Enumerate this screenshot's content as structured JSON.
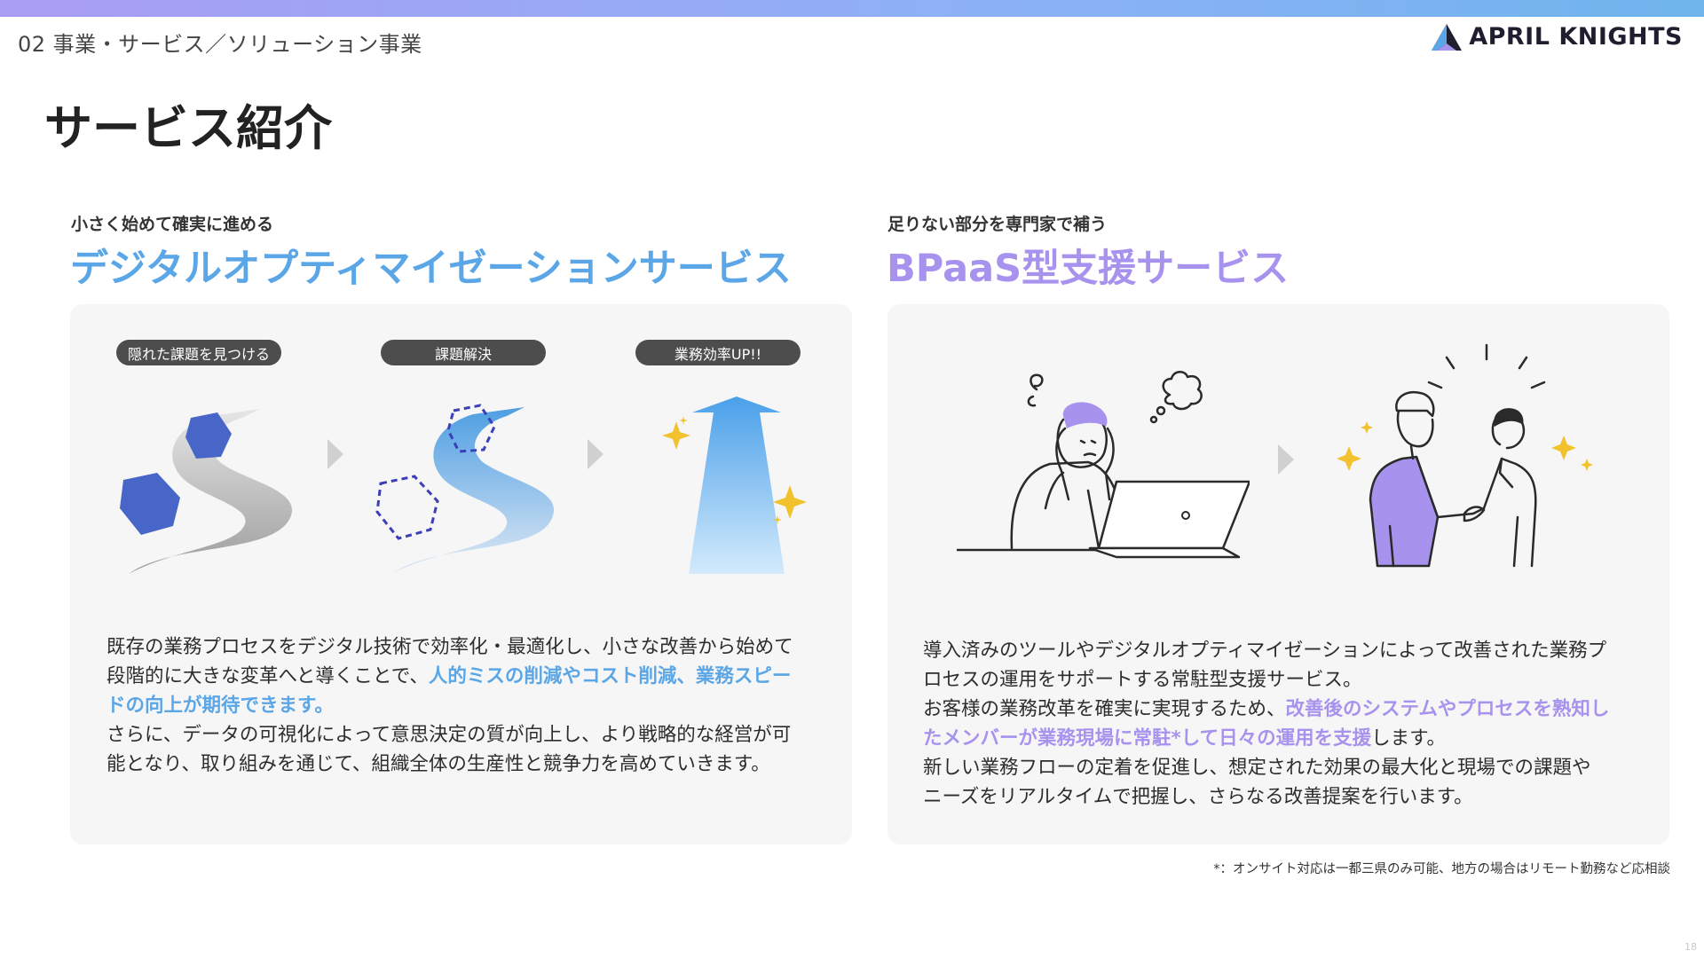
{
  "header": {
    "section_label": "02 事業・サービス／ソリューション事業",
    "brand": "APRIL KNIGHTS",
    "title": "サービス紹介"
  },
  "left": {
    "subtitle": "小さく始めて確実に進める",
    "heading": "デジタルオプティマイゼーションサービス",
    "steps": [
      "隠れた課題を見つける",
      "課題解決",
      "業務効率UP!!"
    ],
    "text": {
      "p1a": "既存の業務プロセスをデジタル技術で効率化・最適化し、小さな改善から始めて",
      "p1b": "段階的に大きな変革へと導くことで、",
      "p1_hl_1": "人的ミスの削減やコスト削減、業務スピー",
      "p1_hl_2": "ドの向上が期待できます。",
      "p2a": "さらに、データの可視化によって意思決定の質が向上し、より戦略的な経営が可",
      "p2b": "能となり、取り組みを通じて、組織全体の生産性と競争力を高めていきます。"
    }
  },
  "right": {
    "subtitle": "足りない部分を専門家で補う",
    "heading": "BPaaS型支援サービス",
    "text": {
      "l1": "導入済みのツールやデジタルオプティマイゼーションによって改善された業務プ",
      "l2": "ロセスの運用をサポートする常駐型支援サービス。",
      "l3a": "お客様の業務改革を確実に実現するため、",
      "l3_hl": "改善後のシステムやプロセスを熟知し",
      "l4_hl": "たメンバーが業務現場に常駐*して日々の運用を支援",
      "l4b": "します。",
      "l5": "新しい業務フローの定着を促進し、想定された効果の最大化と現場での課題や",
      "l6": "ニーズをリアルタイムで把握し、さらなる改善提案を行います。"
    }
  },
  "footnote": "*：オンサイト対応は一都三県のみ可能、地方の場合はリモート勤務など応相談",
  "page_number": "18",
  "colors": {
    "accent_blue": "#5aa6e6",
    "accent_purple": "#a793ee",
    "rock_blue": "#4766c8",
    "pill_bg": "#4d4d4d",
    "panel_bg": "#f6f6f6"
  },
  "icons": [
    "april-knights-logo-icon",
    "road-with-rocks-icon",
    "road-solved-icon",
    "efficiency-arrow-icon",
    "stressed-worker-icon",
    "handshake-icon",
    "step-arrow-icon"
  ]
}
